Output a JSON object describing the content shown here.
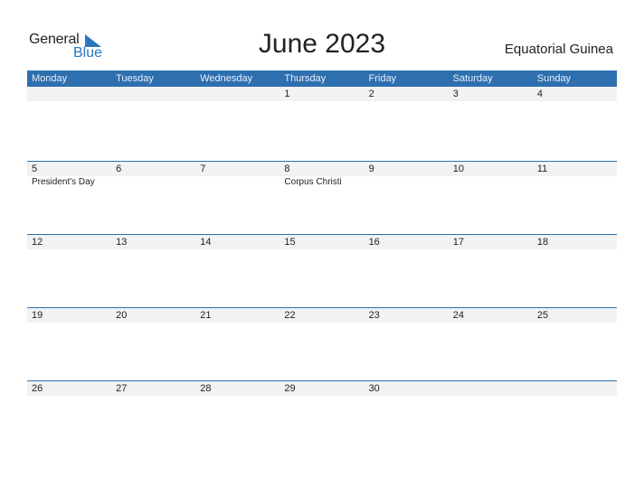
{
  "logo": {
    "general": "General",
    "blue": "Blue",
    "brand_color": "#2a76c1"
  },
  "title": "June 2023",
  "country": "Equatorial Guinea",
  "header_color": "#2e6fb0",
  "weekdays": [
    "Monday",
    "Tuesday",
    "Wednesday",
    "Thursday",
    "Friday",
    "Saturday",
    "Sunday"
  ],
  "weeks": [
    {
      "days": [
        {
          "num": "",
          "holiday": ""
        },
        {
          "num": "",
          "holiday": ""
        },
        {
          "num": "",
          "holiday": ""
        },
        {
          "num": "1",
          "holiday": ""
        },
        {
          "num": "2",
          "holiday": ""
        },
        {
          "num": "3",
          "holiday": ""
        },
        {
          "num": "4",
          "holiday": ""
        }
      ]
    },
    {
      "days": [
        {
          "num": "5",
          "holiday": "President's Day"
        },
        {
          "num": "6",
          "holiday": ""
        },
        {
          "num": "7",
          "holiday": ""
        },
        {
          "num": "8",
          "holiday": "Corpus Christi"
        },
        {
          "num": "9",
          "holiday": ""
        },
        {
          "num": "10",
          "holiday": ""
        },
        {
          "num": "11",
          "holiday": ""
        }
      ]
    },
    {
      "days": [
        {
          "num": "12",
          "holiday": ""
        },
        {
          "num": "13",
          "holiday": ""
        },
        {
          "num": "14",
          "holiday": ""
        },
        {
          "num": "15",
          "holiday": ""
        },
        {
          "num": "16",
          "holiday": ""
        },
        {
          "num": "17",
          "holiday": ""
        },
        {
          "num": "18",
          "holiday": ""
        }
      ]
    },
    {
      "days": [
        {
          "num": "19",
          "holiday": ""
        },
        {
          "num": "20",
          "holiday": ""
        },
        {
          "num": "21",
          "holiday": ""
        },
        {
          "num": "22",
          "holiday": ""
        },
        {
          "num": "23",
          "holiday": ""
        },
        {
          "num": "24",
          "holiday": ""
        },
        {
          "num": "25",
          "holiday": ""
        }
      ]
    },
    {
      "days": [
        {
          "num": "26",
          "holiday": ""
        },
        {
          "num": "27",
          "holiday": ""
        },
        {
          "num": "28",
          "holiday": ""
        },
        {
          "num": "29",
          "holiday": ""
        },
        {
          "num": "30",
          "holiday": ""
        },
        {
          "num": "",
          "holiday": ""
        },
        {
          "num": "",
          "holiday": ""
        }
      ]
    }
  ]
}
